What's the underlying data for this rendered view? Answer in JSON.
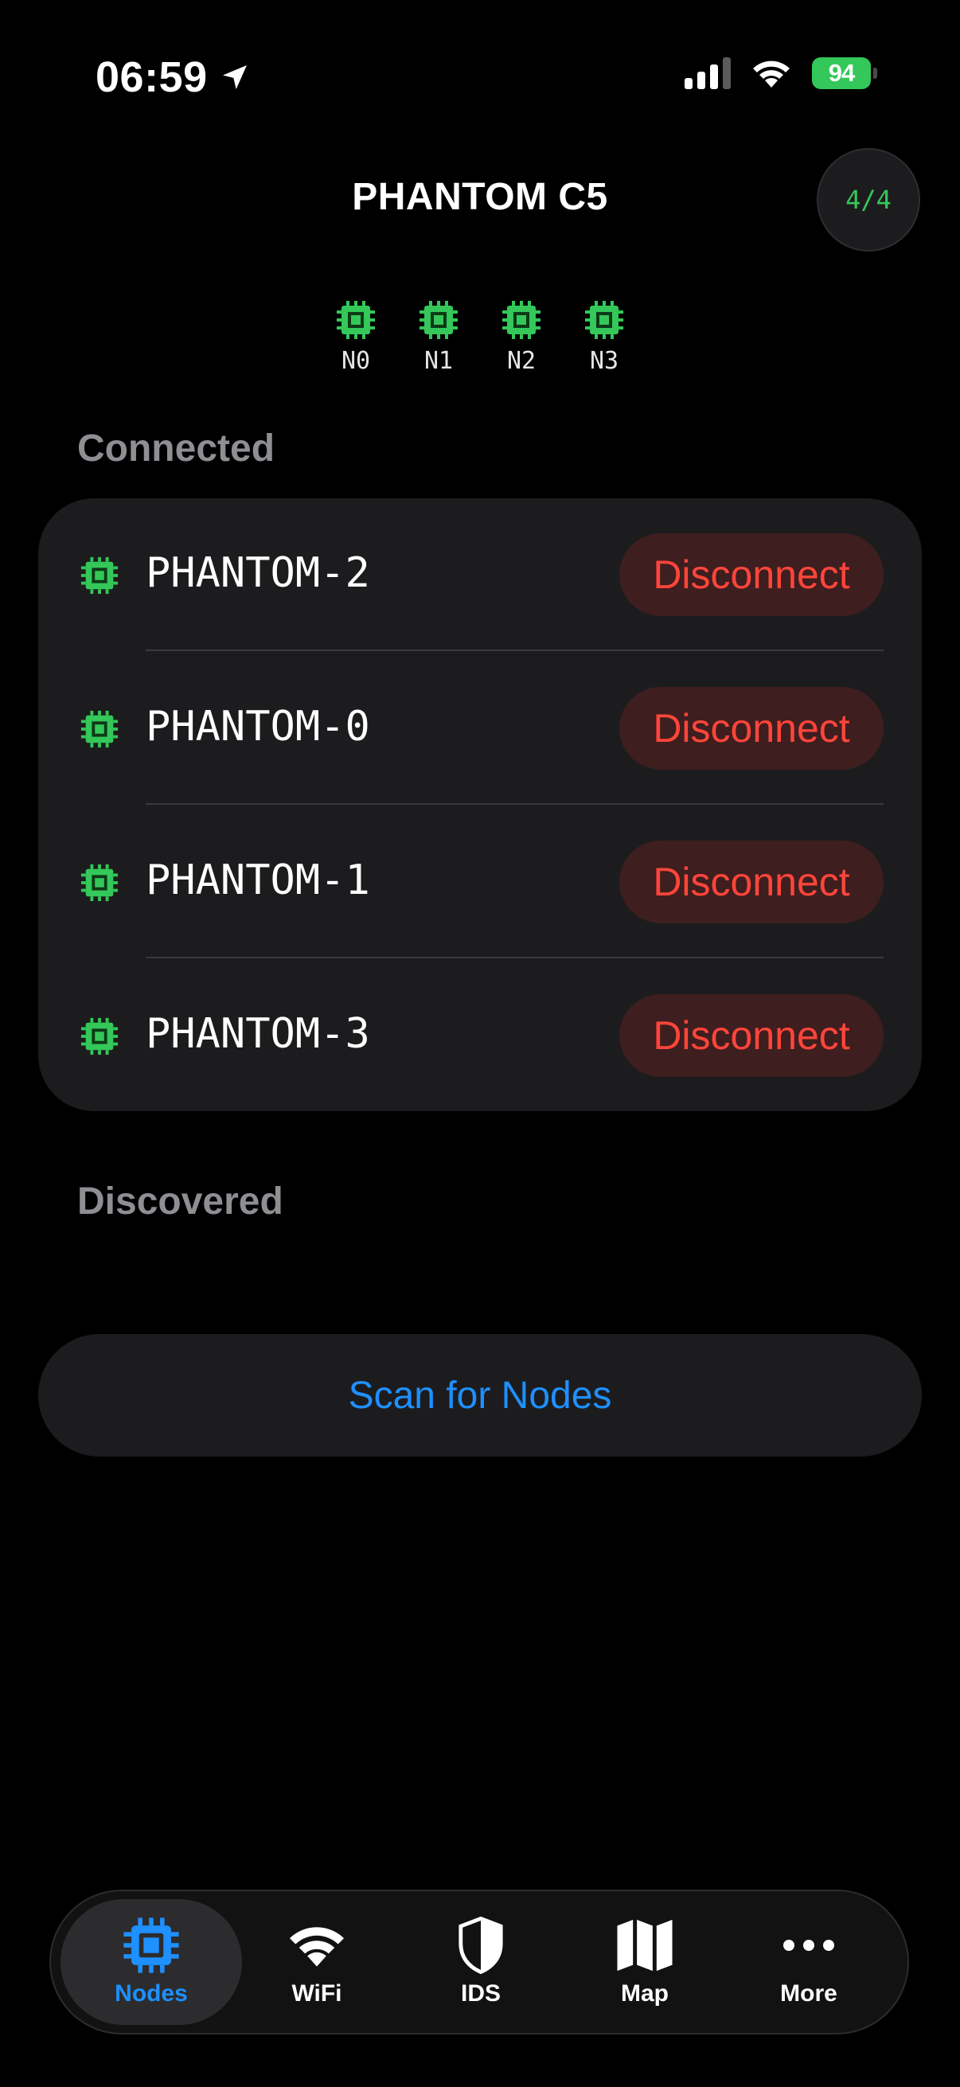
{
  "status_bar": {
    "time": "06:59",
    "battery": "94"
  },
  "header": {
    "title": "PHANTOM C5",
    "count": "4/4"
  },
  "node_strip": [
    "N0",
    "N1",
    "N2",
    "N3"
  ],
  "sections": {
    "connected": "Connected",
    "discovered": "Discovered"
  },
  "connected_nodes": [
    {
      "name": "PHANTOM-2",
      "action": "Disconnect"
    },
    {
      "name": "PHANTOM-0",
      "action": "Disconnect"
    },
    {
      "name": "PHANTOM-1",
      "action": "Disconnect"
    },
    {
      "name": "PHANTOM-3",
      "action": "Disconnect"
    }
  ],
  "scan_label": "Scan for Nodes",
  "tabs": [
    {
      "label": "Nodes",
      "icon": "chip-icon",
      "active": true
    },
    {
      "label": "WiFi",
      "icon": "wifi-icon"
    },
    {
      "label": "IDS",
      "icon": "shield-icon"
    },
    {
      "label": "Map",
      "icon": "map-icon"
    },
    {
      "label": "More",
      "icon": "ellipsis-icon"
    }
  ],
  "colors": {
    "accent_green": "#34c759",
    "accent_blue": "#1e90ff",
    "danger_red": "#ff453a"
  }
}
